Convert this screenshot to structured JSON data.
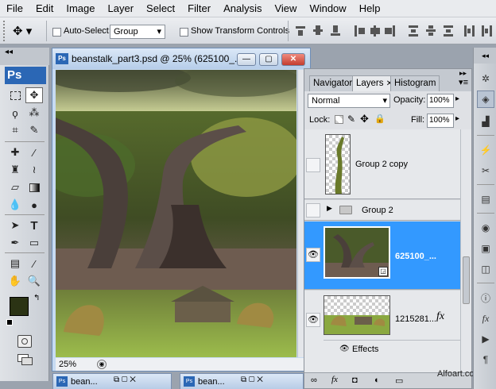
{
  "menu": [
    "File",
    "Edit",
    "Image",
    "Layer",
    "Select",
    "Filter",
    "Analysis",
    "View",
    "Window",
    "Help"
  ],
  "options": {
    "auto_select_label": "Auto-Select:",
    "auto_select_value": "Group",
    "transform_label": "Show Transform Controls"
  },
  "toolbox": {
    "logo": "Ps"
  },
  "document": {
    "title": "beanstalk_part3.psd @ 25% (625100_...",
    "zoom": "25%"
  },
  "bottom_tabs": [
    "bean...",
    "bean..."
  ],
  "layers_panel": {
    "tabs": [
      "Navigator",
      "Layers",
      "Histogram"
    ],
    "active_tab": "Layers",
    "blend_mode": "Normal",
    "opacity_label": "Opacity:",
    "opacity_value": "100%",
    "lock_label": "Lock:",
    "fill_label": "Fill:",
    "fill_value": "100%",
    "layers": [
      {
        "name": "Group 2 copy"
      },
      {
        "name": "Group 2"
      },
      {
        "name": "625100_..."
      },
      {
        "name": "1215281..."
      }
    ],
    "effects_label": "Effects",
    "fx_label": "fx"
  },
  "watermark": "Alfoart.com",
  "colors": {
    "selection": "#3399ff",
    "title_bar": "#c7dbf2",
    "close_button": "#d9534f",
    "foreground_swatch": "#2b3314"
  }
}
